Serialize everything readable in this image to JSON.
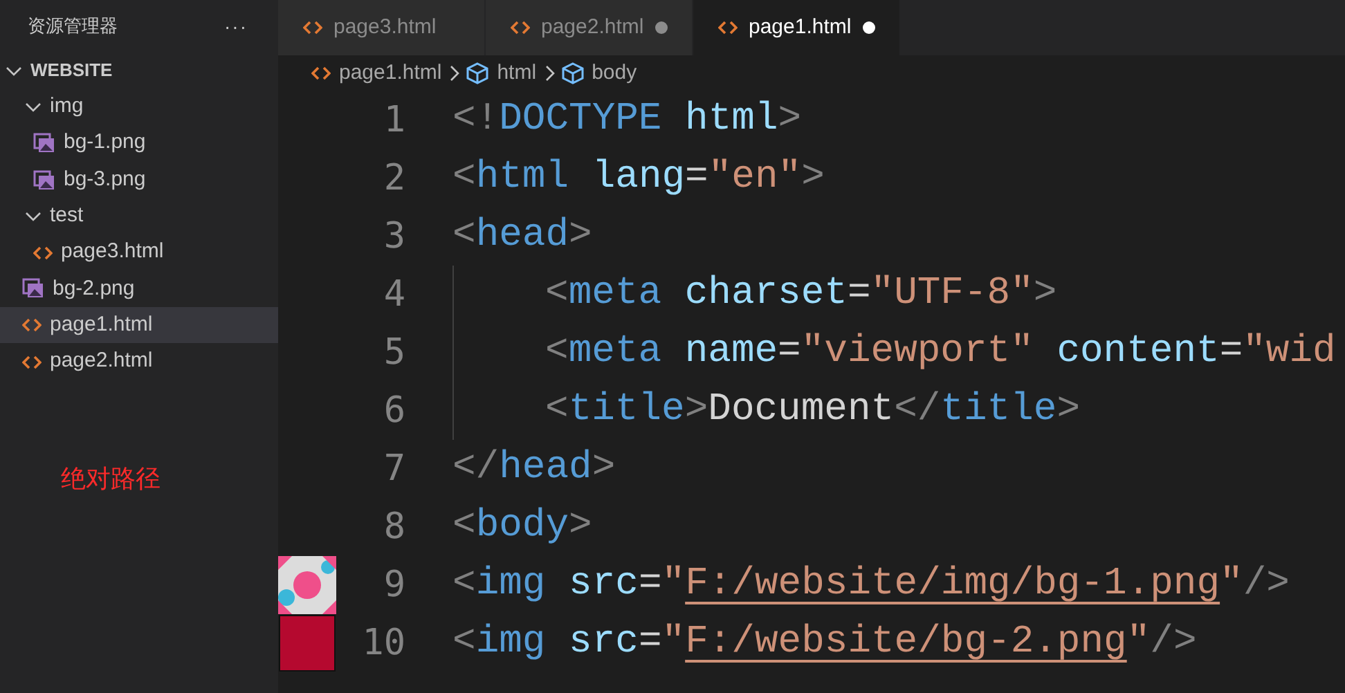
{
  "sidebar": {
    "title": "资源管理器",
    "more": "···",
    "tree": [
      {
        "name": "WEBSITE",
        "kind": "root",
        "expanded": true,
        "selected": false,
        "children": [
          {
            "name": "img",
            "kind": "folder",
            "expanded": true,
            "selected": false,
            "children": [
              {
                "name": "bg-1.png",
                "kind": "image",
                "selected": false
              },
              {
                "name": "bg-3.png",
                "kind": "image",
                "selected": false
              }
            ]
          },
          {
            "name": "test",
            "kind": "folder",
            "expanded": true,
            "selected": false,
            "children": [
              {
                "name": "page3.html",
                "kind": "html",
                "selected": false
              }
            ]
          },
          {
            "name": "bg-2.png",
            "kind": "image",
            "selected": false
          },
          {
            "name": "page1.html",
            "kind": "html",
            "selected": true
          },
          {
            "name": "page2.html",
            "kind": "html",
            "selected": false
          }
        ]
      }
    ],
    "note": "绝对路径"
  },
  "tabs": [
    {
      "label": "page3.html",
      "selected": false,
      "modified": false
    },
    {
      "label": "page2.html",
      "selected": false,
      "modified": true
    },
    {
      "label": "page1.html",
      "selected": true,
      "modified": true
    }
  ],
  "breadcrumb": [
    {
      "label": "page1.html",
      "kind": "file"
    },
    {
      "label": "html",
      "kind": "element"
    },
    {
      "label": "body",
      "kind": "element"
    }
  ],
  "code": [
    {
      "number": "1",
      "kind": "plain",
      "tokens": [
        {
          "kind": "punct",
          "text": "<!"
        },
        {
          "kind": "tag",
          "text": "DOCTYPE"
        },
        {
          "kind": "attr",
          "text": " html"
        },
        {
          "kind": "punct",
          "text": ">"
        }
      ]
    },
    {
      "number": "2",
      "kind": "plain",
      "tokens": [
        {
          "kind": "punct",
          "text": "<"
        },
        {
          "kind": "tag",
          "text": "html"
        },
        {
          "kind": "attr",
          "text": " lang"
        },
        {
          "kind": "plain",
          "text": "="
        },
        {
          "kind": "string",
          "text": "\"en\""
        },
        {
          "kind": "punct",
          "text": ">"
        }
      ]
    },
    {
      "number": "3",
      "kind": "plain",
      "tokens": [
        {
          "kind": "punct",
          "text": "<"
        },
        {
          "kind": "tag",
          "text": "head"
        },
        {
          "kind": "punct",
          "text": ">"
        }
      ]
    },
    {
      "number": "4",
      "kind": "plain",
      "indent": true,
      "tokens": [
        {
          "kind": "punct",
          "text": "<"
        },
        {
          "kind": "tag",
          "text": "meta"
        },
        {
          "kind": "attr",
          "text": " charset"
        },
        {
          "kind": "plain",
          "text": "="
        },
        {
          "kind": "string",
          "text": "\"UTF-8\""
        },
        {
          "kind": "punct",
          "text": ">"
        }
      ]
    },
    {
      "number": "5",
      "kind": "plain",
      "indent": true,
      "tokens": [
        {
          "kind": "punct",
          "text": "<"
        },
        {
          "kind": "tag",
          "text": "meta"
        },
        {
          "kind": "attr",
          "text": " name"
        },
        {
          "kind": "plain",
          "text": "="
        },
        {
          "kind": "string",
          "text": "\"viewport\""
        },
        {
          "kind": "attr",
          "text": " content"
        },
        {
          "kind": "plain",
          "text": "="
        },
        {
          "kind": "string",
          "text": "\"wid"
        }
      ]
    },
    {
      "number": "6",
      "kind": "plain",
      "indent": true,
      "tokens": [
        {
          "kind": "punct",
          "text": "<"
        },
        {
          "kind": "tag",
          "text": "title"
        },
        {
          "kind": "punct",
          "text": ">"
        },
        {
          "kind": "plain",
          "text": "Document"
        },
        {
          "kind": "punct",
          "text": "</"
        },
        {
          "kind": "tag",
          "text": "title"
        },
        {
          "kind": "punct",
          "text": ">"
        }
      ]
    },
    {
      "number": "7",
      "kind": "plain",
      "tokens": [
        {
          "kind": "punct",
          "text": "</"
        },
        {
          "kind": "tag",
          "text": "head"
        },
        {
          "kind": "punct",
          "text": ">"
        }
      ]
    },
    {
      "number": "8",
      "kind": "plain",
      "tokens": [
        {
          "kind": "punct",
          "text": "<"
        },
        {
          "kind": "tag",
          "text": "body"
        },
        {
          "kind": "punct",
          "text": ">"
        }
      ]
    },
    {
      "number": "9",
      "kind": "image-preview",
      "tokens": [
        {
          "kind": "punct",
          "text": "<"
        },
        {
          "kind": "tag",
          "text": "img"
        },
        {
          "kind": "attr",
          "text": " src"
        },
        {
          "kind": "plain",
          "text": "="
        },
        {
          "kind": "string",
          "text": "\""
        },
        {
          "kind": "link",
          "text": "F:/website/img/bg-1.png"
        },
        {
          "kind": "string",
          "text": "\""
        },
        {
          "kind": "punct",
          "text": "/>"
        }
      ]
    },
    {
      "number": "10",
      "kind": "color-preview",
      "tokens": [
        {
          "kind": "punct",
          "text": "<"
        },
        {
          "kind": "tag",
          "text": "img"
        },
        {
          "kind": "attr",
          "text": " src"
        },
        {
          "kind": "plain",
          "text": "="
        },
        {
          "kind": "string",
          "text": "\""
        },
        {
          "kind": "link",
          "text": "F:/website/bg-2.png"
        },
        {
          "kind": "string",
          "text": "\""
        },
        {
          "kind": "punct",
          "text": "/>"
        }
      ]
    }
  ]
}
